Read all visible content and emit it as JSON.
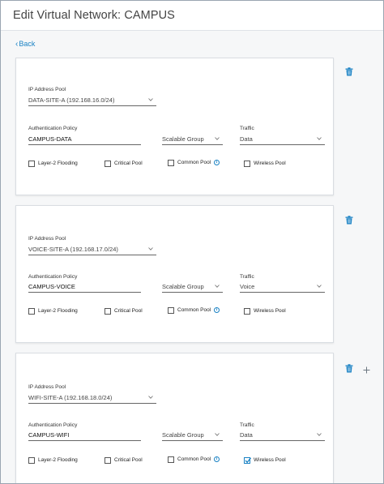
{
  "header": {
    "title": "Edit Virtual Network: CAMPUS"
  },
  "back_link": {
    "label": "Back"
  },
  "labels": {
    "ip_pool": "IP Address Pool",
    "auth_policy": "Authentication Policy",
    "traffic": "Traffic",
    "layer2": "Layer-2 Flooding",
    "critical": "Critical Pool",
    "common": "Common Pool",
    "wireless": "Wireless Pool",
    "info_glyph": "i"
  },
  "pools": [
    {
      "ip_pool": "DATA-SITE-A (192.168.16.0/24)",
      "auth_policy": "CAMPUS-DATA",
      "scalable_group": "Scalable Group",
      "traffic": "Data",
      "layer2_checked": false,
      "critical_checked": false,
      "common_checked": false,
      "wireless_checked": false
    },
    {
      "ip_pool": "VOICE-SITE-A (192.168.17.0/24)",
      "auth_policy": "CAMPUS-VOICE",
      "scalable_group": "Scalable Group",
      "traffic": "Voice",
      "layer2_checked": false,
      "critical_checked": false,
      "common_checked": false,
      "wireless_checked": false
    },
    {
      "ip_pool": "WIFI-SITE-A (192.168.18.0/24)",
      "auth_policy": "CAMPUS-WIFI",
      "scalable_group": "Scalable Group",
      "traffic": "Data",
      "layer2_checked": false,
      "critical_checked": false,
      "common_checked": false,
      "wireless_checked": true
    }
  ],
  "icons": {
    "delete": "trash-icon",
    "add": "plus-icon",
    "dropdown": "chevron-down-icon",
    "info": "info-icon",
    "back": "chevron-left-icon"
  },
  "colors": {
    "accent": "#1a82c4",
    "border": "#d9dde2",
    "background": "#f6f7f8"
  }
}
